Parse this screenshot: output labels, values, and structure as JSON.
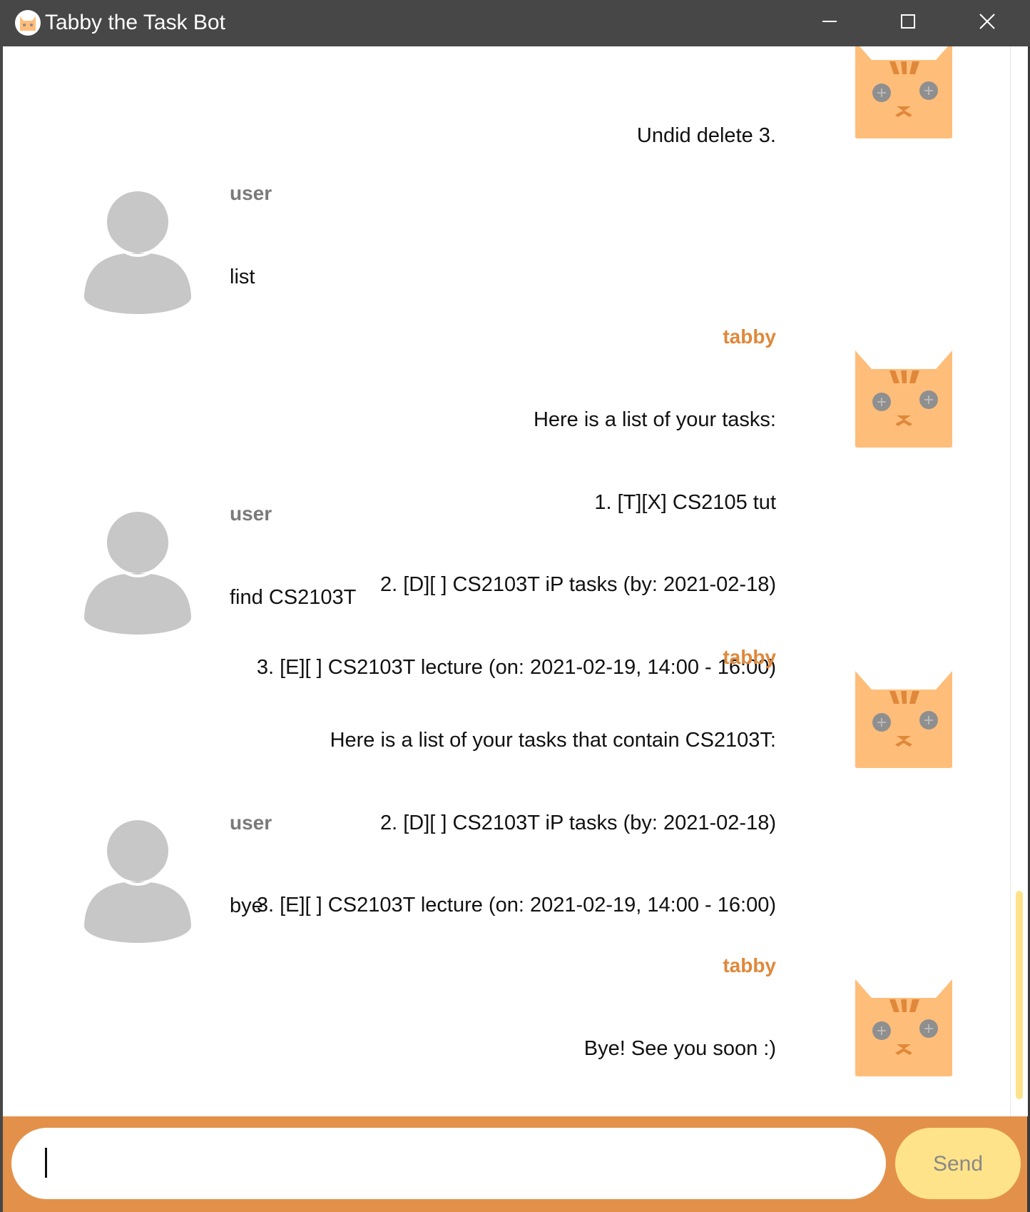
{
  "window": {
    "title": "Tabby the Task Bot",
    "minimize_icon": "minimize-icon",
    "maximize_icon": "maximize-icon",
    "close_icon": "close-icon"
  },
  "messages": [
    {
      "sender": "tabby",
      "show_name": false,
      "lines": [
        "Undid delete 3."
      ]
    },
    {
      "sender": "user",
      "show_name": true,
      "lines": [
        "list"
      ]
    },
    {
      "sender": "tabby",
      "show_name": true,
      "lines": [
        "Here is a list of your tasks:",
        "1. [T][X] CS2105 tut",
        "2. [D][ ] CS2103T iP tasks (by: 2021-02-18)",
        "3. [E][ ] CS2103T lecture (on: 2021-02-19, 14:00 - 16:00)"
      ]
    },
    {
      "sender": "user",
      "show_name": true,
      "lines": [
        "find CS2103T"
      ]
    },
    {
      "sender": "tabby",
      "show_name": true,
      "lines": [
        "Here is a list of your tasks that contain CS2103T:",
        "2. [D][ ] CS2103T iP tasks (by: 2021-02-18)",
        "3. [E][ ] CS2103T lecture (on: 2021-02-19, 14:00 - 16:00)"
      ]
    },
    {
      "sender": "user",
      "show_name": true,
      "lines": [
        "bye"
      ]
    },
    {
      "sender": "tabby",
      "show_name": true,
      "lines": [
        "Bye! See you soon :)"
      ]
    }
  ],
  "names": {
    "user": "user",
    "bot": "tabby"
  },
  "input": {
    "value": "",
    "placeholder": ""
  },
  "send_button": {
    "label": "Send"
  },
  "colors": {
    "titlebar": "#474747",
    "accent_orange": "#e3914a",
    "bot_name": "#e0883a",
    "user_name": "#7a7a7a",
    "send_button": "#ffe38a",
    "cat_face": "#ffbd7a",
    "user_avatar": "#c7c7c7"
  }
}
